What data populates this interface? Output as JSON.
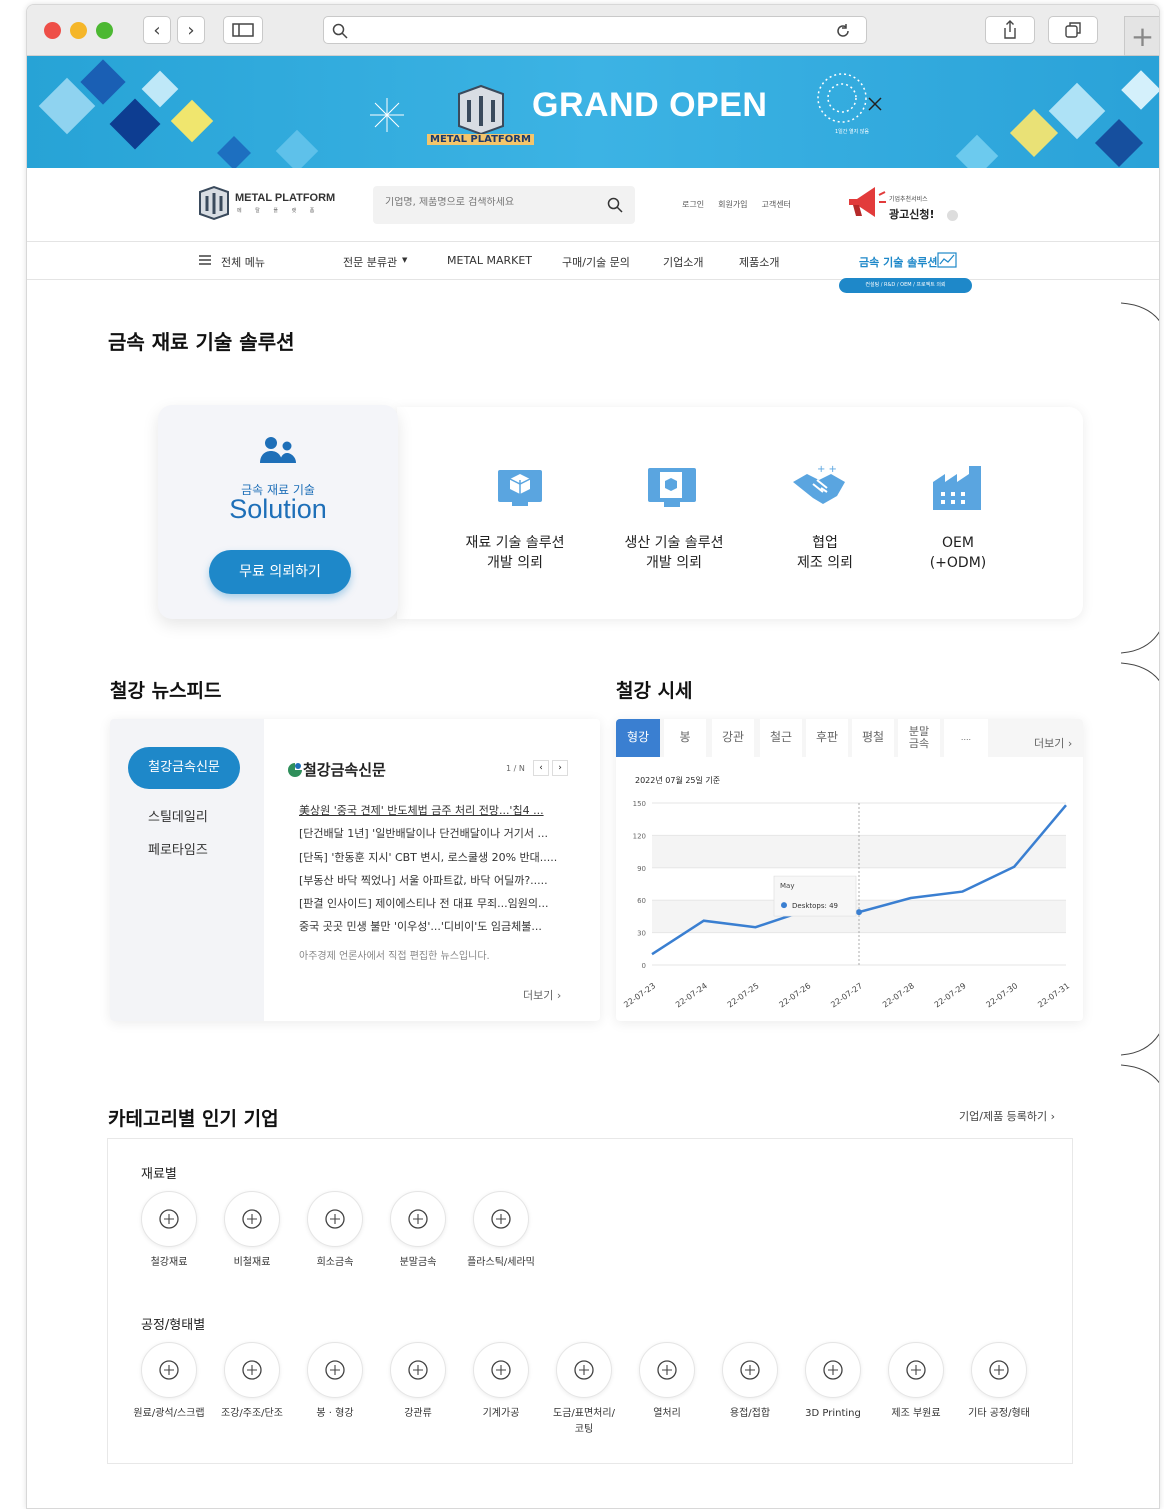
{
  "banner": {
    "title": "GRAND OPEN",
    "logo_text": "METAL PLATFORM",
    "promo_text": "1일간 열지 않음"
  },
  "header": {
    "logo_name": "METAL PLATFORM",
    "logo_sub": "메 탈 플 랫 폼",
    "search_placeholder": "기업명, 제품명으로 검색하세요",
    "links": [
      "로그인",
      "회원가입",
      "고객센터"
    ],
    "ad_small": "기업추천서비스",
    "ad_big": "광고신청!"
  },
  "nav": {
    "all_menu": "전체 메뉴",
    "items": [
      "전문 분류관",
      "METAL MARKET",
      "구매/기술 문의",
      "기업소개",
      "제품소개"
    ],
    "active": "금속 기술 솔루션",
    "active_sub": "컨설팅 / R&D / OEM / 프로젝트 의뢰"
  },
  "solution": {
    "heading": "금속 재료 기술 솔루션",
    "card_small": "금속 재료 기술",
    "card_big": "Solution",
    "cta": "무료 의뢰하기",
    "items": [
      {
        "line1": "재료 기술 솔루션",
        "line2": "개발 의뢰"
      },
      {
        "line1": "생산 기술 솔루션",
        "line2": "개발 의뢰"
      },
      {
        "line1": "협업",
        "line2": "제조 의뢰"
      },
      {
        "line1": "OEM",
        "line2": "(+ODM)"
      }
    ]
  },
  "news": {
    "heading": "철강 뉴스피드",
    "sources": [
      "철강금속신문",
      "스틸데일리",
      "페로타임즈"
    ],
    "active_title": "철강금속신문",
    "pager": "1 / N",
    "lines": [
      "美상원 '중국 견제' 반도체법 금주 처리 전망...'칩4 ...",
      "[단건배달 1년] '일반배달이나 단건배달이나 거기서 ...",
      "[단독] '한동훈 지시' CBT 변시, 로스쿨생 20% 반대.....",
      "[부동산 바닥 찍었나] 서울 아파트값, 바닥 어딜까?.....",
      "[판결 인사이드] 제이에스티나 전 대표 무죄...임원의...",
      "중국 곳곳 민생 불만 '이우성'...'디비이'도 임금체불..."
    ],
    "note": "아주경제 언론사에서 직접 편집한 뉴스입니다.",
    "more": "더보기"
  },
  "price": {
    "heading": "철강 시세",
    "tabs": [
      "형강",
      "봉",
      "강관",
      "철근",
      "후판",
      "평철",
      "분말금속",
      "...."
    ],
    "more": "더보기",
    "date": "2022년 07월 25일 기준",
    "tooltip_title": "May",
    "tooltip_label": "Desktops:",
    "tooltip_value": "49"
  },
  "chart_data": {
    "type": "line",
    "categories": [
      "22-07-23",
      "22-07-24",
      "22-07-25",
      "22-07-26",
      "22-07-27",
      "22-07-28",
      "22-07-29",
      "22-07-30",
      "22-07-31"
    ],
    "series": [
      {
        "name": "Desktops",
        "values": [
          10,
          41,
          35,
          51,
          49,
          62,
          68,
          91,
          148
        ]
      }
    ],
    "ylim": [
      0,
      150
    ],
    "yticks": [
      0,
      30,
      60,
      90,
      120,
      150
    ],
    "grid": true,
    "color": "#3a7fd1"
  },
  "categories": {
    "heading": "카테고리별 인기 기업",
    "register": "기업/제품 등록하기",
    "material_title": "재료별",
    "materials": [
      "철강재료",
      "비철재료",
      "희소금속",
      "분말금속",
      "플라스틱/세라믹"
    ],
    "process_title": "공정/형태별",
    "processes": [
      "원료/광석/스크랩",
      "조강/주조/단조",
      "봉 · 형강",
      "강관류",
      "기계가공",
      "도금/표면처리/\n코팅",
      "열처리",
      "용접/접합",
      "3D Printing",
      "제조 부원료",
      "기타 공정/형태"
    ]
  },
  "colors": {
    "accent": "#1e88c9",
    "banner": "#2ea9dd",
    "primary_blue": "#3a7fd1"
  }
}
